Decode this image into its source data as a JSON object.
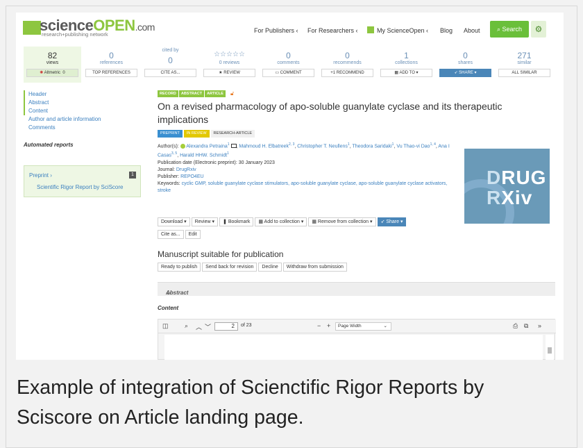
{
  "header": {
    "logo": {
      "part1": "science",
      "part2": "OPEN",
      "part3": ".com",
      "tagline": "research+publishing network"
    },
    "nav": [
      "For Publishers ‹",
      "For Researchers ‹",
      "My ScienceOpen ‹",
      "Blog",
      "About"
    ],
    "search_label": "Search"
  },
  "stats": [
    {
      "num": "82",
      "label": "views",
      "action": "0"
    },
    {
      "num": "0",
      "label": "references",
      "action": "TOP REFERENCES"
    },
    {
      "num": "0",
      "label": "cited by",
      "action": "CITE AS..."
    },
    {
      "num": "☆☆☆☆☆",
      "label": "0 reviews",
      "action": "REVIEW"
    },
    {
      "num": "0",
      "label": "comments",
      "action": "COMMENT"
    },
    {
      "num": "0",
      "label": "recommends",
      "action": "+1 RECOMMEND"
    },
    {
      "num": "1",
      "label": "collections",
      "action": "ADD TO ▾"
    },
    {
      "num": "0",
      "label": "shares",
      "action": "SHARE ▾"
    },
    {
      "num": "271",
      "label": "similar",
      "action": "ALL SIMILAR"
    }
  ],
  "sidebar": {
    "nav": [
      "Header",
      "Abstract",
      "Content"
    ],
    "items": [
      "Author and article information",
      "Comments"
    ],
    "automated_heading": "Automated reports",
    "preprint_label": "Preprint ›",
    "preprint_count": "1",
    "report_link": "Scientific Rigor Report by SciScore"
  },
  "article": {
    "tags": [
      "RECORD",
      "ABSTRACT",
      "ARTICLE"
    ],
    "title": "On a revised pharmacology of apo-soluble guanylate cyclase and its therapeutic implications",
    "badges": [
      "PREPRINT",
      "IN REVIEW",
      "RESEARCH-ARTICLE"
    ],
    "authors_label": "Author(s):",
    "authors": [
      {
        "name": "Alexandra Petraina",
        "sup": "1"
      },
      {
        "name": "Mahmoud H. Elbatreek",
        "sup": "2, 3"
      },
      {
        "name": "Christopher T. Neullens",
        "sup": "1"
      },
      {
        "name": "Theodora Saridaki",
        "sup": "1"
      },
      {
        "name": "Vu Thao-vi Dao",
        "sup": "1, 4"
      },
      {
        "name": "Ana I Casas",
        "sup": "3, 5"
      },
      {
        "name": "Harald HHW. Schmidt",
        "sup": "1"
      }
    ],
    "pub_date_label": "Publication date (Electronic preprint):",
    "pub_date": "30 January 2023",
    "journal_label": "Journal:",
    "journal": "DrugRxiv",
    "publisher_label": "Publisher:",
    "publisher": "REPO4EU",
    "keywords_label": "Keywords:",
    "keywords": "cyclic GMP, soluble guanylate cyclase stimulators, apo-soluble guanylate cyclase, apo-soluble guanylate cyclase activators, stroke",
    "cover_line1": "RUG",
    "cover_line2": "Xiv",
    "cover_d": "D",
    "cover_r": "R"
  },
  "actions": {
    "download": "Download ▾",
    "review": "Review ▾",
    "bookmark": "Bookmark",
    "add_collection": "Add to collection ▾",
    "remove_collection": "Remove from collection ▾",
    "share": "Share ▾",
    "cite": "Cite as...",
    "edit": "Edit"
  },
  "manuscript": {
    "heading": "Manuscript suitable for publication",
    "buttons": [
      "Ready to publish",
      "Send back for revision",
      "Decline",
      "Withdraw from submission"
    ]
  },
  "abstract_label": "Abstract",
  "content_label": "Content",
  "pdf": {
    "page": "2",
    "of": "of 23",
    "zoom": "Page Width"
  },
  "caption": "Example of integration of Scienctific Rigor Reports by Sciscore on Article landing page."
}
